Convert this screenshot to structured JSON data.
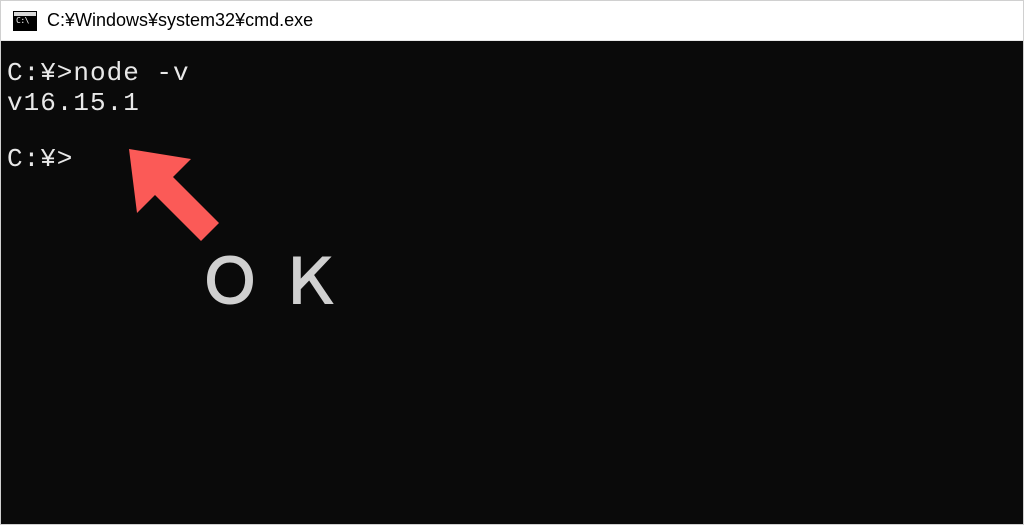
{
  "titlebar": {
    "icon_glyph": "C:\\",
    "title": "C:¥Windows¥system32¥cmd.exe"
  },
  "terminal": {
    "line1_prompt": "C:¥>",
    "line1_command": "node -v",
    "line2_output": "v16.15.1",
    "line3_prompt": "C:¥>"
  },
  "annotation": {
    "label": "ＯＫ",
    "arrow_color": "#fb5a57"
  }
}
